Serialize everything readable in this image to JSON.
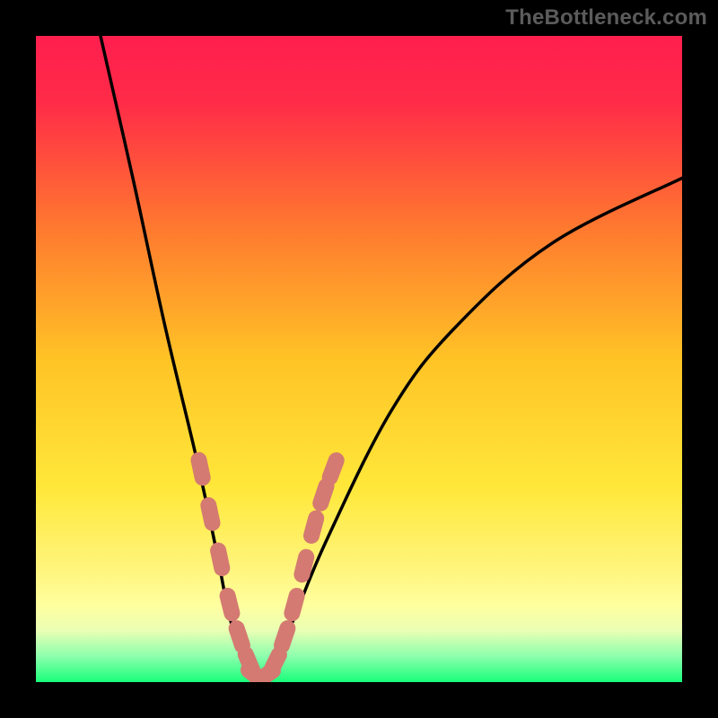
{
  "attribution": "TheBottleneck.com",
  "colors": {
    "frame": "#000000",
    "gradient_top": "#ff1f4e",
    "gradient_mid": "#ffe23a",
    "gradient_band": "#ffff8e",
    "gradient_bottom": "#19ff7a",
    "curve": "#000000",
    "data_points": "#d47a72"
  },
  "chart_data": {
    "type": "line",
    "title": "",
    "xlabel": "",
    "ylabel": "",
    "xlim": [
      0,
      100
    ],
    "ylim": [
      0,
      100
    ],
    "curve": {
      "description": "V-shaped bottleneck curve with minimum near x≈34",
      "min_x": 34,
      "points_left": [
        {
          "x": 10,
          "y": 100
        },
        {
          "x": 15,
          "y": 78
        },
        {
          "x": 20,
          "y": 55
        },
        {
          "x": 25,
          "y": 34
        },
        {
          "x": 28,
          "y": 20
        },
        {
          "x": 30,
          "y": 10
        },
        {
          "x": 32,
          "y": 4
        },
        {
          "x": 34,
          "y": 0
        }
      ],
      "points_right": [
        {
          "x": 34,
          "y": 0
        },
        {
          "x": 37,
          "y": 3
        },
        {
          "x": 40,
          "y": 10
        },
        {
          "x": 45,
          "y": 22
        },
        {
          "x": 55,
          "y": 42
        },
        {
          "x": 65,
          "y": 55
        },
        {
          "x": 80,
          "y": 68
        },
        {
          "x": 100,
          "y": 78
        }
      ]
    },
    "series": [
      {
        "name": "highlighted-data-points",
        "color": "#d47a72",
        "points": [
          {
            "x": 25.5,
            "y": 33
          },
          {
            "x": 27.0,
            "y": 26
          },
          {
            "x": 28.5,
            "y": 19
          },
          {
            "x": 30.0,
            "y": 12
          },
          {
            "x": 31.5,
            "y": 7
          },
          {
            "x": 33.0,
            "y": 3
          },
          {
            "x": 34.0,
            "y": 1
          },
          {
            "x": 35.5,
            "y": 1
          },
          {
            "x": 37.0,
            "y": 3
          },
          {
            "x": 38.5,
            "y": 7
          },
          {
            "x": 40.0,
            "y": 12
          },
          {
            "x": 41.5,
            "y": 18
          },
          {
            "x": 43.0,
            "y": 24
          },
          {
            "x": 44.5,
            "y": 29
          },
          {
            "x": 46.0,
            "y": 33
          }
        ]
      }
    ]
  }
}
